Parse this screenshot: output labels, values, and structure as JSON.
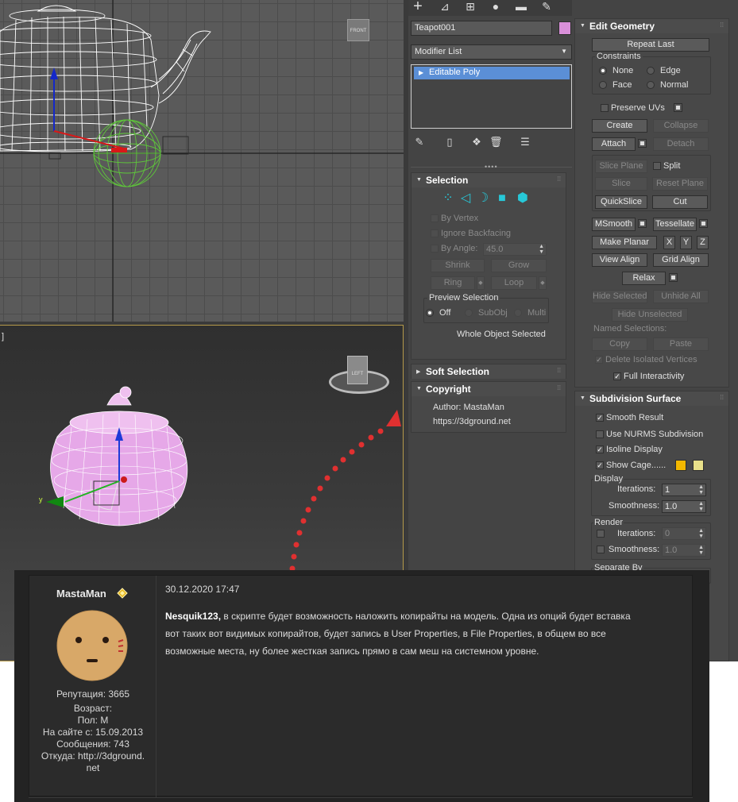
{
  "viewports": {
    "top_label": "",
    "persp_label": "]",
    "viewcube_top": "FRONT",
    "viewcube_persp": "LEFT"
  },
  "command_panel": {
    "tabs": [
      "create-icon",
      "modify-icon",
      "hierarchy-icon",
      "motion-icon",
      "display-icon",
      "utilities-icon"
    ],
    "object_name": "Teapot001",
    "object_color": "#d88fd8",
    "modifier_list": "Modifier List",
    "stack_item": "Editable Poly",
    "selection": {
      "title": "Selection",
      "by_vertex": "By Vertex",
      "ignore_backfacing": "Ignore Backfacing",
      "by_angle": "By Angle:",
      "angle_value": "45.0",
      "shrink": "Shrink",
      "grow": "Grow",
      "ring": "Ring",
      "loop": "Loop",
      "preview_selection": "Preview Selection",
      "preview_off": "Off",
      "preview_subobj": "SubObj",
      "preview_multi": "Multi",
      "status": "Whole Object Selected"
    },
    "soft_selection": {
      "title": "Soft Selection"
    },
    "copyright": {
      "title": "Copyright",
      "author": "Author:  MastaMan",
      "url": "https://3dground.net"
    }
  },
  "edit_geometry": {
    "title": "Edit Geometry",
    "repeat_last": "Repeat Last",
    "constraints": "Constraints",
    "none": "None",
    "edge": "Edge",
    "face": "Face",
    "normal": "Normal",
    "preserve_uvs": "Preserve UVs",
    "create": "Create",
    "collapse": "Collapse",
    "attach": "Attach",
    "detach": "Detach",
    "slice_plane": "Slice Plane",
    "split": "Split",
    "slice": "Slice",
    "reset_plane": "Reset Plane",
    "quickslice": "QuickSlice",
    "cut": "Cut",
    "msmooth": "MSmooth",
    "tessellate": "Tessellate",
    "make_planar": "Make Planar",
    "x": "X",
    "y": "Y",
    "z": "Z",
    "view_align": "View Align",
    "grid_align": "Grid Align",
    "relax": "Relax",
    "hide_selected": "Hide Selected",
    "unhide_all": "Unhide All",
    "hide_unselected": "Hide Unselected",
    "named_selections": "Named Selections:",
    "copy": "Copy",
    "paste": "Paste",
    "delete_isolated": "Delete Isolated Vertices",
    "full_interactivity": "Full Interactivity"
  },
  "subdivision": {
    "title": "Subdivision Surface",
    "smooth_result": "Smooth Result",
    "use_nurms": "Use NURMS Subdivision",
    "isoline_display": "Isoline Display",
    "show_cage": "Show Cage......",
    "cage_color_1": "#f3b800",
    "cage_color_2": "#e8e08a",
    "display": "Display",
    "iterations": "Iterations:",
    "iterations_value": "1",
    "smoothness": "Smoothness:",
    "smoothness_value": "1.0",
    "render": "Render",
    "render_iterations": "Iterations:",
    "render_iterations_value": "0",
    "render_smoothness": "Smoothness:",
    "render_smoothness_value": "1.0",
    "separate_by": "Separate By"
  },
  "forum": {
    "username": "MastaMan",
    "reputation": "Репутация: 3665",
    "age": "Возраст:",
    "gender": "Пол: M",
    "since": "На сайте с: 15.09.2013",
    "messages": "Сообщения: 743",
    "from_line1": "Откуда: http://3dground.",
    "from_line2": "net",
    "date": "30.12.2020 17:47",
    "addressee": "Nesquik123,",
    "text_line1": " в скрипте будет возможность наложить копирайты на модель. Одна из опций будет вставка",
    "text_line2": "вот таких вот видимых копирайтов, будет запись в User Properties, в File Properties, в общем во все",
    "text_line3": "возможные места, ну более жесткая запись прямо в сам меш на системном уровне."
  }
}
